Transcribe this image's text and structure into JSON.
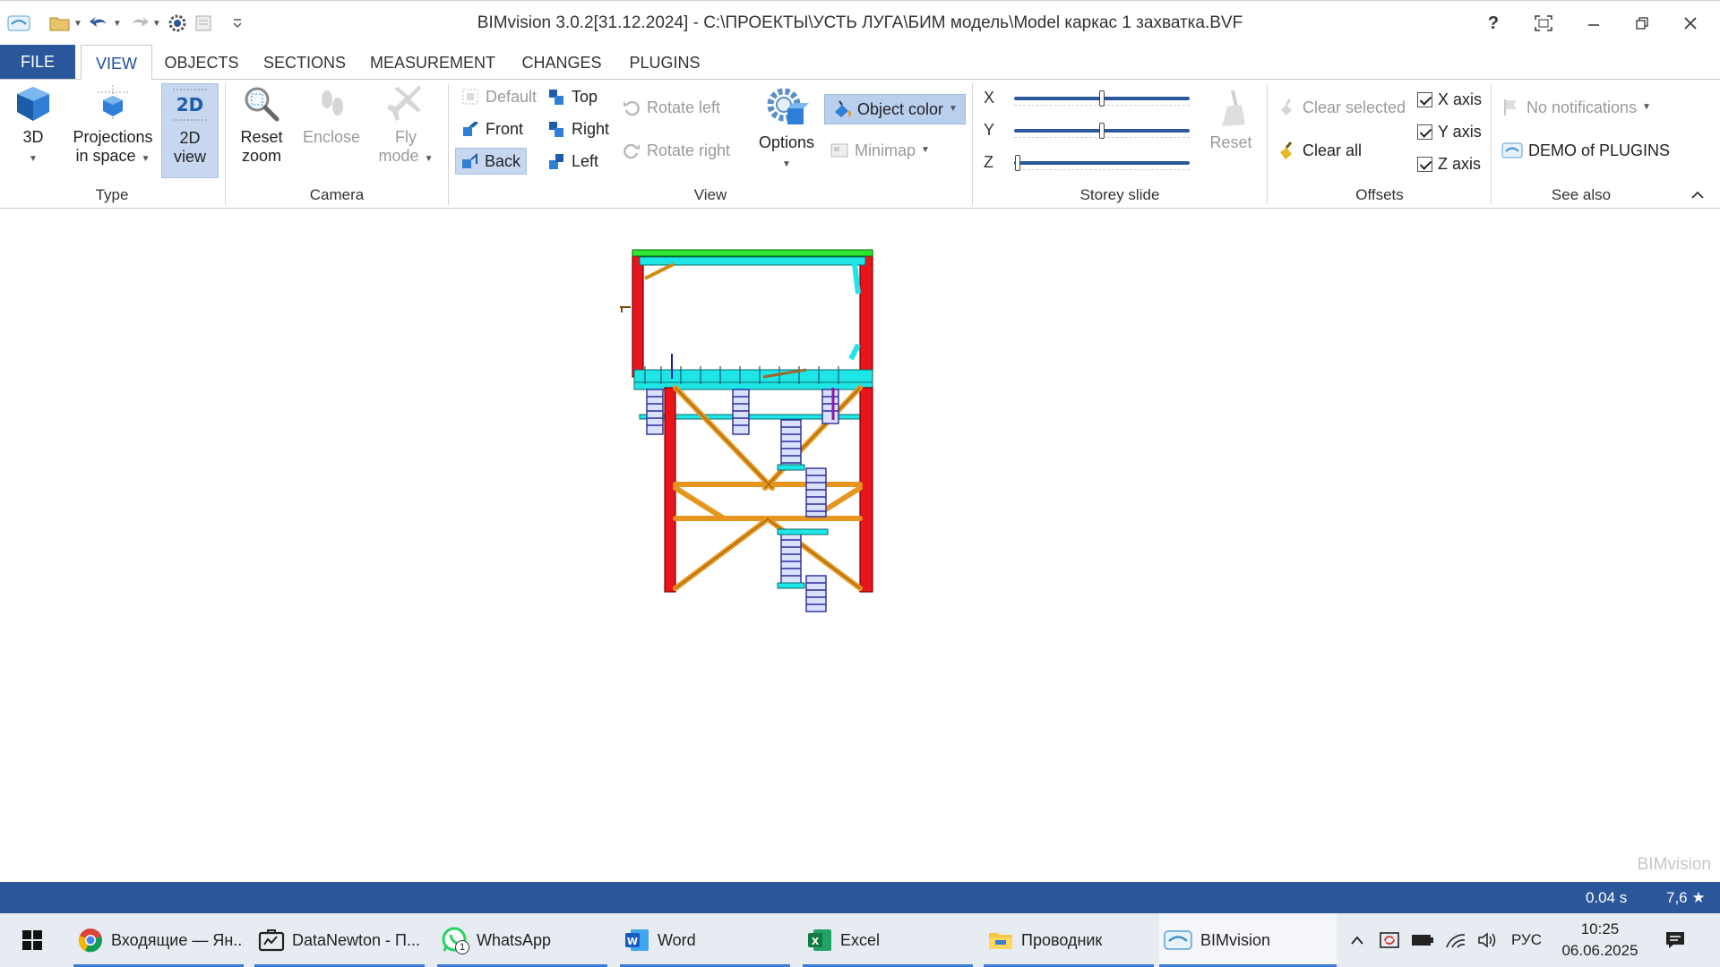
{
  "window": {
    "title": "BIMvision 3.0.2[31.12.2024] - C:\\ПРОЕКТЫ\\УСТЬ ЛУГА\\БИМ модель\\Model каркас 1 захватка.BVF",
    "help": "?"
  },
  "tabs": {
    "file": "FILE",
    "view": "VIEW",
    "objects": "OBJECTS",
    "sections": "SECTIONS",
    "measurement": "MEASUREMENT",
    "changes": "CHANGES",
    "plugins": "PLUGINS"
  },
  "ribbon": {
    "type": {
      "label": "Type",
      "btn_3d": "3D",
      "projections_1": "Projections",
      "projections_2": "in space",
      "view2d_1": "2D",
      "view2d_2": "view"
    },
    "camera": {
      "label": "Camera",
      "reset_1": "Reset",
      "reset_2": "zoom",
      "enclose": "Enclose",
      "fly_1": "Fly",
      "fly_2": "mode"
    },
    "view": {
      "label": "View",
      "default": "Default",
      "front": "Front",
      "back": "Back",
      "top": "Top",
      "right": "Right",
      "left": "Left",
      "rotate_left": "Rotate left",
      "rotate_right": "Rotate right",
      "options": "Options",
      "object_color": "Object color",
      "minimap": "Minimap"
    },
    "storey": {
      "label": "Storey slide",
      "x": "X",
      "y": "Y",
      "z": "Z",
      "reset": "Reset",
      "x_level": 0.5,
      "y_level": 0.5,
      "z_level": 0.02
    },
    "offsets": {
      "label": "Offsets",
      "clear_selected": "Clear selected",
      "clear_all": "Clear all",
      "x_axis": "X axis",
      "y_axis": "Y axis",
      "z_axis": "Z axis",
      "x_checked": true,
      "y_checked": true,
      "z_checked": true
    },
    "see_also": {
      "label": "See also",
      "notifications": "No notifications",
      "demo": "DEMO of PLUGINS"
    }
  },
  "viewport": {
    "watermark": "BIMvision"
  },
  "status": {
    "time": "0.04 s",
    "rating": "7,6 ★"
  },
  "taskbar": {
    "items": [
      {
        "label": "Входящие — Ян..."
      },
      {
        "label": "DataNewton - П..."
      },
      {
        "label": "WhatsApp"
      },
      {
        "label": "Word"
      },
      {
        "label": "Excel"
      },
      {
        "label": "Проводник"
      },
      {
        "label": "BIMvision"
      }
    ],
    "whatsapp_badge": "1",
    "lang": "РУС",
    "time": "10:25",
    "date": "06.06.2025"
  },
  "colors": {
    "accent": "#2a579a",
    "steel_red": "#e8141c",
    "brace_orange": "#e6961e",
    "deck_cyan": "#1ee6e6",
    "stair_blue": "#2a2a9a"
  }
}
